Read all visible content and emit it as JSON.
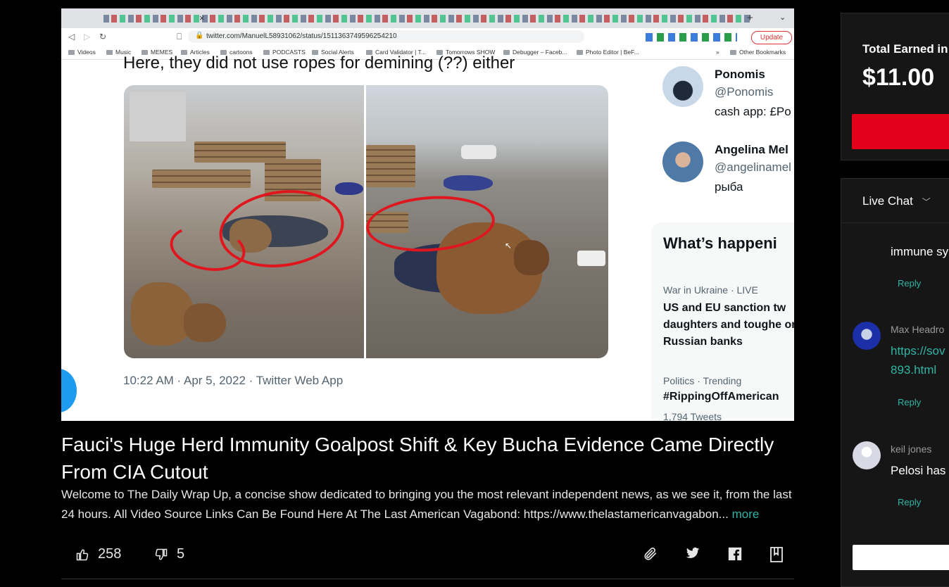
{
  "browser": {
    "url": "twitter.com/ManuelL58931062/status/1511363749596254210",
    "update_label": "Update",
    "bookmarks": [
      "Videos",
      "Music",
      "MEMES",
      "Articles",
      "cartoons",
      "PODCASTS",
      "Social Alerts",
      "Card Validator | T...",
      "Tomorrows SHOW",
      "Debugger – Faceb...",
      "Photo Editor | BeF..."
    ],
    "bookmarks_overflow": "»",
    "other_bookmarks": "Other Bookmarks"
  },
  "tweet": {
    "headline": "Here, they did not use ropes for demining (??) either",
    "timestamp": "10:22 AM · Apr 5, 2022 · Twitter Web App"
  },
  "twitter_sidebar": {
    "suggestions": [
      {
        "name": "Ponomis",
        "handle": "@Ponomis",
        "bio": "cash app: £Po"
      },
      {
        "name": "Angelina Mel",
        "handle": "@angelinamel",
        "bio": "рыба"
      }
    ],
    "happening_title": "What’s happeni",
    "trends": [
      {
        "meta": "War in Ukraine · LIVE",
        "text": "US and EU sanction tw daughters and toughe on Russian banks"
      },
      {
        "meta": "Politics · Trending",
        "text": "#RippingOffAmerican",
        "count": "1,794 Tweets"
      }
    ]
  },
  "video": {
    "title": "Fauci's Huge Herd Immunity Goalpost Shift & Key Bucha Evidence Came Directly From CIA Cutout",
    "description": "Welcome to The Daily Wrap Up, a concise show dedicated to bringing you the most relevant independent news, as we see it, from the last 24 hours. All Video Source Links Can Be Found Here At The Last American Vagabond: https://www.thelastamericanvagabon...",
    "more_label": "more",
    "likes": "258",
    "dislikes": "5"
  },
  "earnings": {
    "label": "Total Earned in T",
    "amount": "$11.00"
  },
  "chat": {
    "header": "Live Chat",
    "partial_text": "immune sy",
    "reply_label": "Reply",
    "messages": [
      {
        "author": "Max Headro",
        "lines": [
          "https://sov",
          "893.html"
        ]
      },
      {
        "author": "keil jones",
        "lines": [
          "Pelosi has c"
        ]
      }
    ]
  },
  "colors": {
    "accent_teal": "#2fb5a5",
    "earn_red": "#e3001b",
    "twitter_blue": "#1d9bf0"
  }
}
